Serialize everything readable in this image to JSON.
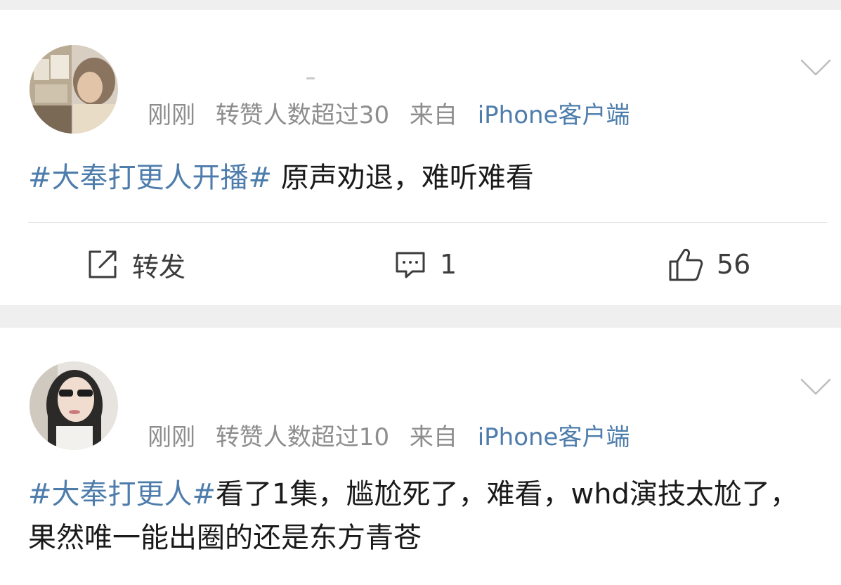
{
  "posts": [
    {
      "username": "",
      "time": "刚刚",
      "repost_stat": "转赞人数超过30",
      "source_prefix": "来自",
      "source": "iPhone客户端",
      "hashtag": "#大奉打更人开播#",
      "text": " 原声劝退，难听难看",
      "actions": {
        "repost_label": "转发",
        "comment_count": "1",
        "like_count": "56"
      }
    },
    {
      "time": "刚刚",
      "repost_stat": "转赞人数超过10",
      "source_prefix": "来自",
      "source": "iPhone客户端",
      "hashtag": "#大奉打更人#",
      "text": "看了1集，尴尬死了，难看，whd演技太尬了，果然唯一能出圈的还是东方青苍"
    }
  ],
  "icons": {
    "repost": "repost-icon",
    "comment": "comment-icon",
    "like": "like-icon",
    "more": "chevron-down-icon"
  },
  "colors": {
    "link": "#4e7dac",
    "meta_text": "#8d8d8d",
    "body_text": "#1a1a1a",
    "background": "#efefef",
    "card": "#ffffff"
  }
}
